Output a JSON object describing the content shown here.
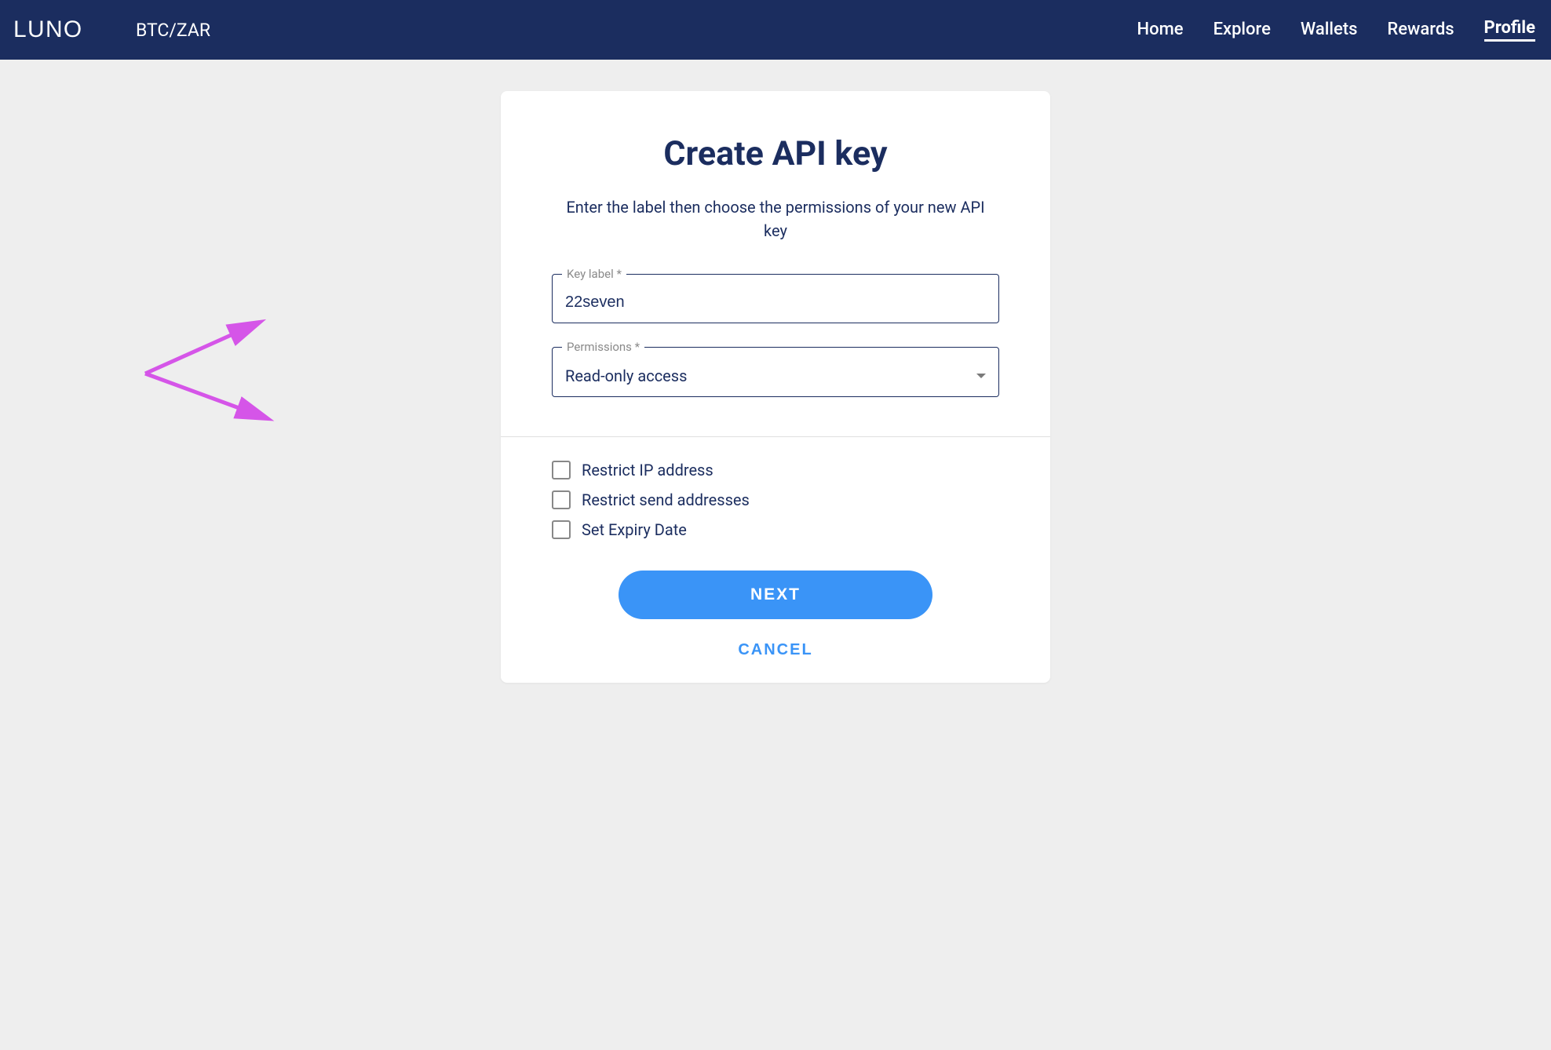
{
  "header": {
    "logo_text": "LUNO",
    "pair": "BTC/ZAR",
    "nav": [
      {
        "label": "Home",
        "active": false
      },
      {
        "label": "Explore",
        "active": false
      },
      {
        "label": "Wallets",
        "active": false
      },
      {
        "label": "Rewards",
        "active": false
      },
      {
        "label": "Profile",
        "active": true
      }
    ]
  },
  "form": {
    "title": "Create API key",
    "subtitle": "Enter the label then choose the permissions of your new API key",
    "key_label_field": {
      "label": "Key label *",
      "value": "22seven"
    },
    "permissions_field": {
      "label": "Permissions *",
      "value": "Read-only access"
    },
    "checkboxes": [
      {
        "label": "Restrict IP address",
        "checked": false
      },
      {
        "label": "Restrict send addresses",
        "checked": false
      },
      {
        "label": "Set Expiry Date",
        "checked": false
      }
    ],
    "next_button": "NEXT",
    "cancel_button": "CANCEL"
  }
}
